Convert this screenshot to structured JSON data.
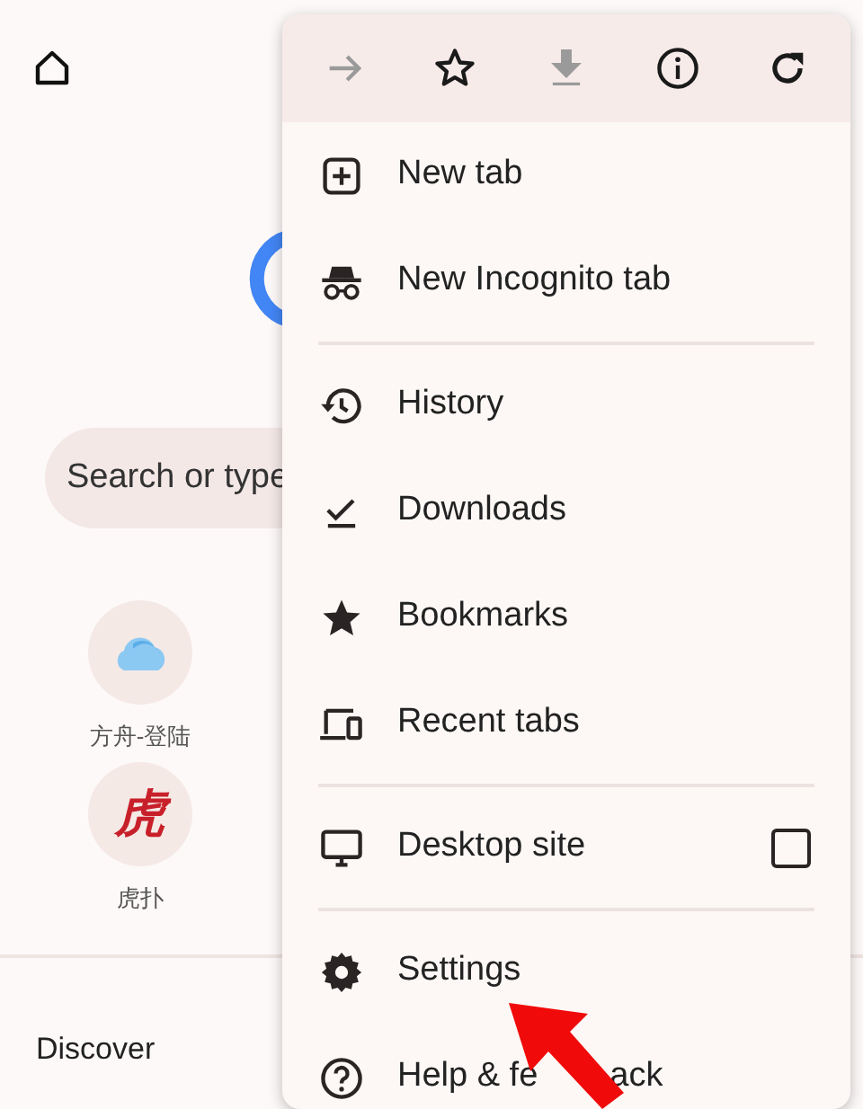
{
  "page": {
    "search": {
      "placeholder": "Search or type"
    },
    "shortcuts": [
      {
        "label": "方舟-登陆",
        "kind": "cloud"
      },
      {
        "label": "虎扑",
        "kind": "glyph",
        "glyph": "虎"
      }
    ],
    "discover": "Discover"
  },
  "menu": {
    "toolbar": [
      {
        "kind": "forward",
        "disabled": true
      },
      {
        "kind": "star",
        "disabled": false
      },
      {
        "kind": "download",
        "disabled": true
      },
      {
        "kind": "info",
        "disabled": false
      },
      {
        "kind": "reload",
        "disabled": false
      }
    ],
    "sections": [
      [
        {
          "kind": "new-tab",
          "label": "New tab"
        },
        {
          "kind": "incognito",
          "label": "New Incognito tab"
        }
      ],
      [
        {
          "kind": "history",
          "label": "History"
        },
        {
          "kind": "downloads",
          "label": "Downloads"
        },
        {
          "kind": "bookmarks",
          "label": "Bookmarks"
        },
        {
          "kind": "recent-tabs",
          "label": "Recent tabs"
        }
      ],
      [
        {
          "kind": "desktop",
          "label": "Desktop site",
          "checked": false
        }
      ],
      [
        {
          "kind": "settings",
          "label": "Settings"
        },
        {
          "kind": "help",
          "label": "Help & fe",
          "label_tail": "ack"
        }
      ]
    ]
  },
  "pointer_arrow": true
}
